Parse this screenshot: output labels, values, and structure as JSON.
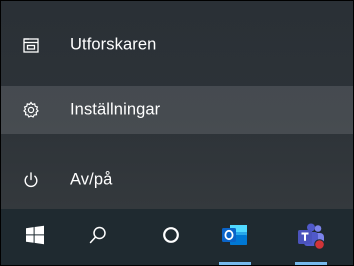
{
  "start_menu": {
    "items": [
      {
        "label": "Utforskaren",
        "icon": "file-explorer-icon"
      },
      {
        "label": "Inställningar",
        "icon": "gear-icon",
        "hovered": true
      },
      {
        "label": "Av/på",
        "icon": "power-icon"
      }
    ]
  },
  "taskbar": {
    "items": [
      {
        "icon": "windows-start-icon"
      },
      {
        "icon": "search-icon"
      },
      {
        "icon": "cortana-icon"
      },
      {
        "icon": "outlook-icon",
        "running": true
      },
      {
        "icon": "teams-icon",
        "running": true,
        "badge": true
      }
    ]
  },
  "colors": {
    "menu_background": "#2d3338",
    "taskbar_background": "#1f2a30",
    "running_indicator": "#76b9ed",
    "outlook_blue": "#0a64c8",
    "teams_purple": "#5558af",
    "badge_red": "#d13438"
  }
}
